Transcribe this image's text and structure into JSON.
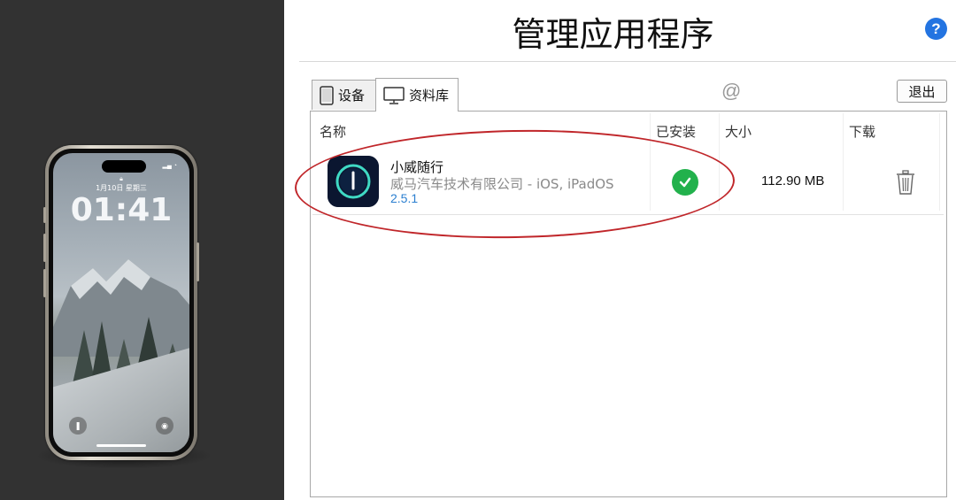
{
  "phone": {
    "lock_date": "1月10日 星期三",
    "lock_time": "01:41"
  },
  "header": {
    "title": "管理应用程序",
    "help_label": "?"
  },
  "tabs": [
    {
      "label": "设备",
      "icon": "phone-device-icon",
      "active": false
    },
    {
      "label": "资料库",
      "icon": "monitor-icon",
      "active": true
    }
  ],
  "toolbar": {
    "at_symbol": "@",
    "logout_label": "退出"
  },
  "table": {
    "columns": [
      "名称",
      "已安装",
      "大小",
      "下载"
    ],
    "rows": [
      {
        "name": "小威随行",
        "vendor": "威马汽车技术有限公司 - iOS, iPadOS",
        "version": "2.5.1",
        "installed": true,
        "size": "112.90 MB",
        "action_icon": "trash-icon"
      }
    ]
  },
  "colors": {
    "left_panel": "#323232",
    "accent_blue": "#2374e1",
    "installed_green": "#22b14c",
    "version_blue": "#2b7fd0",
    "annotation_red": "#c0262a"
  }
}
